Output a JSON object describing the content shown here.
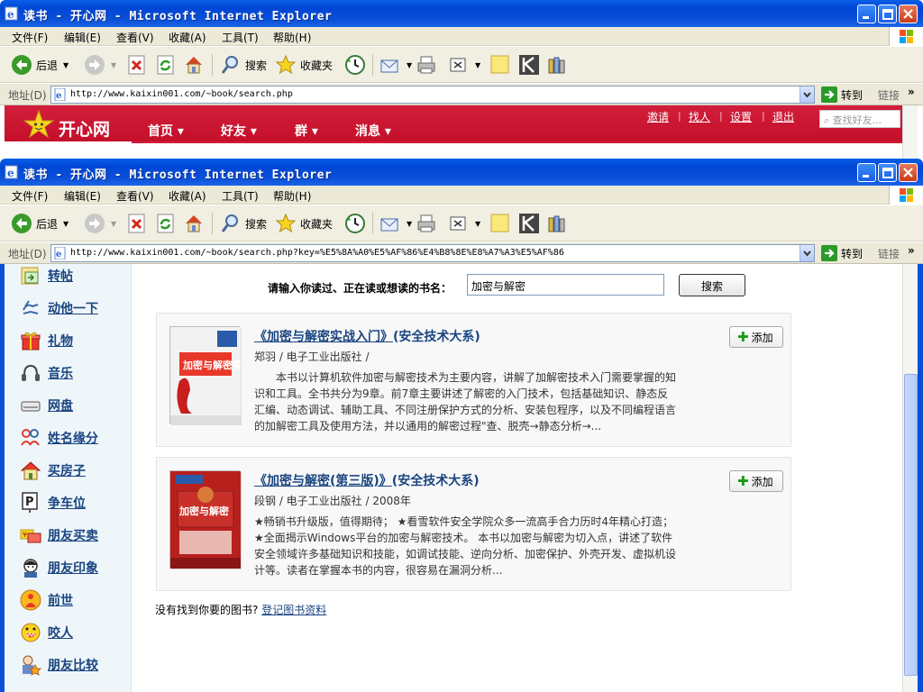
{
  "back_window": {
    "title": "读书 - 开心网 - Microsoft Internet Explorer",
    "url": "http://www.kaixin001.com/~book/search.php",
    "site": {
      "logo": "开心网",
      "nav": [
        "首页",
        "好友",
        "群",
        "消息"
      ],
      "top_links": [
        "邀请",
        "找人",
        "设置",
        "退出"
      ],
      "search_placeholder": "查找好友..."
    }
  },
  "front_window": {
    "title": "读书 - 开心网 - Microsoft Internet Explorer",
    "url": "http://www.kaixin001.com/~book/search.php?key=%E5%8A%A0%E5%AF%86%E4%B8%8E%E8%A7%A3%E5%AF%86"
  },
  "browser": {
    "menus": [
      "文件(F)",
      "编辑(E)",
      "查看(V)",
      "收藏(A)",
      "工具(T)",
      "帮助(H)"
    ],
    "back_label": "后退",
    "search_label": "搜索",
    "favorites_label": "收藏夹",
    "address_label": "地址(D)",
    "go_label": "转到",
    "links_label": "链接",
    "chevron": "»"
  },
  "sidebar": {
    "items": [
      {
        "label": "转帖",
        "icon": "repost-icon"
      },
      {
        "label": "动他一下",
        "icon": "poke-icon"
      },
      {
        "label": "礼物",
        "icon": "gift-icon"
      },
      {
        "label": "音乐",
        "icon": "music-icon"
      },
      {
        "label": "网盘",
        "icon": "disk-icon"
      },
      {
        "label": "姓名缘分",
        "icon": "name-match-icon"
      },
      {
        "label": "买房子",
        "icon": "house-icon"
      },
      {
        "label": "争车位",
        "icon": "parking-icon"
      },
      {
        "label": "朋友买卖",
        "icon": "friend-trade-icon"
      },
      {
        "label": "朋友印象",
        "icon": "impression-icon"
      },
      {
        "label": "前世",
        "icon": "past-life-icon"
      },
      {
        "label": "咬人",
        "icon": "bite-icon"
      },
      {
        "label": "朋友比较",
        "icon": "compare-icon"
      }
    ]
  },
  "search": {
    "label": "请输入你读过、正在读或想读的书名：",
    "value": "加密与解密",
    "button": "搜索"
  },
  "results": [
    {
      "title": "《加密与解密实战入门》",
      "series": "(安全技术大系)",
      "meta": "郑羽 / 电子工业出版社 /",
      "desc": "　　本书以计算机软件加密与解密技术为主要内容，讲解了加解密技术入门需要掌握的知识和工具。全书共分为9章。前7章主要讲述了解密的入门技术，包括基础知识、静态反汇编、动态调试、辅助工具、不同注册保护方式的分析、安装包程序，以及不同编程语言的加解密工具及使用方法，并以通用的解密过程\"查、脱壳→静态分析→...",
      "add": "添加",
      "cover_text": "加密与解密实战入门"
    },
    {
      "title": "《加密与解密(第三版)》",
      "series": "(安全技术大系)",
      "meta": "段钢 / 电子工业出版社 / 2008年",
      "desc": "★畅销书升级版，值得期待；  ★看雪软件安全学院众多一流高手合力历时4年精心打造；  ★全面揭示Windows平台的加密与解密技术。 本书以加密与解密为切入点，讲述了软件安全领域许多基础知识和技能，如调试技能、逆向分析、加密保护、外壳开发、虚拟机设计等。读者在掌握本书的内容，很容易在漏洞分析...",
      "add": "添加",
      "cover_text": "加密与解密"
    }
  ],
  "not_found": {
    "text": "没有找到你要的图书?",
    "link": "登记图书资料"
  }
}
